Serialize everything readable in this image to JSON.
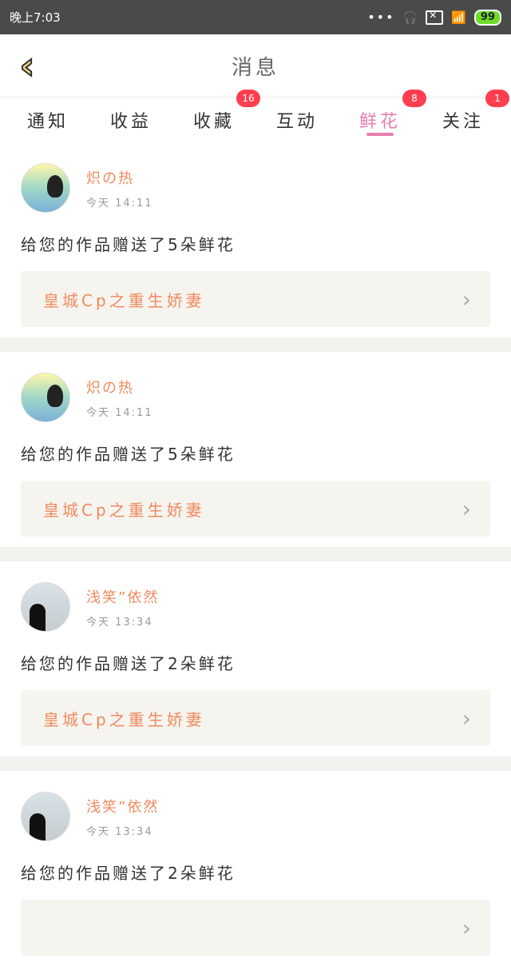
{
  "status": {
    "time": "晚上7:03",
    "battery": "99"
  },
  "header": {
    "title": "消息"
  },
  "tabs": [
    {
      "label": "通知",
      "badge": null
    },
    {
      "label": "收益",
      "badge": null
    },
    {
      "label": "收藏",
      "badge": "16"
    },
    {
      "label": "互动",
      "badge": null
    },
    {
      "label": "鲜花",
      "badge": "8",
      "active": true
    },
    {
      "label": "关注",
      "badge": "1"
    }
  ],
  "items": [
    {
      "user": "炽の热",
      "time": "今天 14:11",
      "message": "给您的作品赠送了5朵鲜花",
      "work": "皇城Cp之重生娇妻",
      "avatar": "penguin"
    },
    {
      "user": "炽の热",
      "time": "今天 14:11",
      "message": "给您的作品赠送了5朵鲜花",
      "work": "皇城Cp之重生娇妻",
      "avatar": "penguin"
    },
    {
      "user": "浅笑”依然",
      "time": "今天 13:34",
      "message": "给您的作品赠送了2朵鲜花",
      "work": "皇城Cp之重生娇妻",
      "avatar": "girl"
    },
    {
      "user": "浅笑”依然",
      "time": "今天 13:34",
      "message": "给您的作品赠送了2朵鲜花",
      "work": "",
      "avatar": "girl"
    }
  ],
  "icons": {
    "back": "chevron-left-icon",
    "chevron": "chevron-right-icon"
  },
  "colors": {
    "accent": "#e67fb0",
    "username": "#f08a5d",
    "badge": "#ff3e50",
    "status_bg": "#4a4a4a"
  }
}
